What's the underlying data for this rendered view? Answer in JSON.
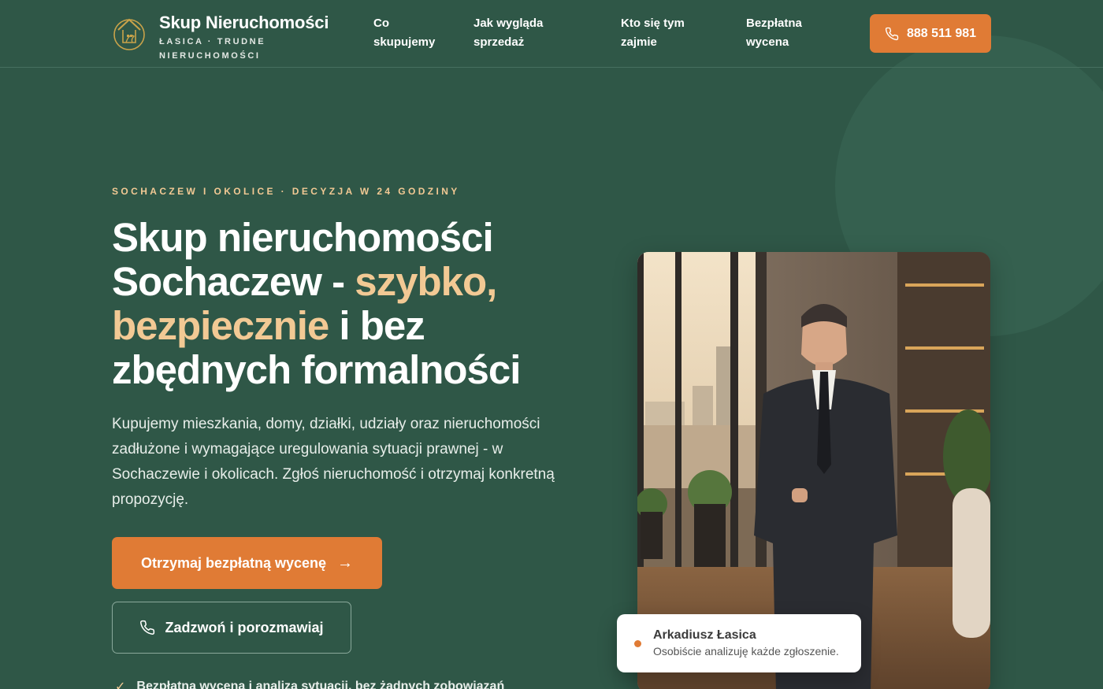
{
  "brand": {
    "title": "Skup Nieruchomości",
    "subtitle": "ŁASICA · TRUDNE NIERUCHOMOŚCI",
    "logo_icon": "house-logo-icon",
    "accent_color": "#e07b35",
    "highlight_color": "#f2c994",
    "background_color": "#2f5747"
  },
  "nav": {
    "items": [
      {
        "label": "Co skupujemy"
      },
      {
        "label": "Jak wygląda sprzedaż"
      },
      {
        "label": "Kto się tym zajmie"
      },
      {
        "label": "Bezpłatna wycena"
      }
    ],
    "phone_label": "888 511 981",
    "phone_icon": "phone-icon"
  },
  "hero": {
    "kicker": "SOCHACZEW I OKOLICE · DECYZJA W 24 GODZINY",
    "title_part1": "Skup nieruchomości Sochaczew - ",
    "title_accent": "szybko, bezpiecznie",
    "title_part2": " i bez zbędnych formalności",
    "lead": "Kupujemy mieszkania, domy, działki, udziały oraz nieruchomości zadłużone i wymagające uregulowania sytuacji prawnej - w Sochaczewie i okolicach. Zgłoś nieruchomość i otrzymaj konkretną propozycję.",
    "cta_primary": "Otrzymaj bezpłatną wycenę",
    "cta_primary_icon": "arrow-right-icon",
    "cta_secondary": "Zadzwoń i porozmawiaj",
    "cta_secondary_icon": "phone-icon",
    "benefit": "Bezpłatna wycena i analiza sytuacji, bez żadnych zobowiązań",
    "benefit_icon": "check-icon"
  },
  "person": {
    "name": "Arkadiusz Łasica",
    "description": "Osobiście analizuję każde zgłoszenie."
  }
}
